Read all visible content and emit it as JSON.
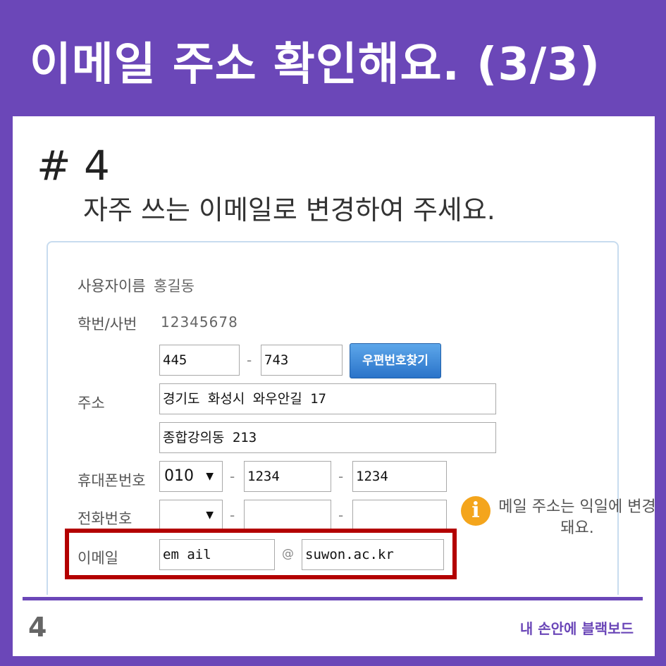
{
  "header": {
    "title": "이메일 주소 확인해요. (3/3)"
  },
  "step": {
    "number": "# 4",
    "subtitle": "자주 쓰는 이메일로 변경하여 주세요."
  },
  "form": {
    "username_label": "사용자이름",
    "username_value": "홍길동",
    "student_id_label": "학번/사번",
    "student_id_value": "12345678",
    "zip1": "445",
    "zip_dash": "-",
    "zip2": "743",
    "zip_button": "우편번호찾기",
    "address_label": "주소",
    "address1": "경기도 화성시 와우안길 17",
    "address2": "종합강의동 213",
    "mobile_label": "휴대폰번호",
    "mobile_prefix": "010",
    "mobile_dash": "-",
    "mobile_mid": "1234",
    "mobile_last": "1234",
    "phone_label": "전화번호",
    "phone_prefix": "",
    "phone_dash": "-",
    "phone_mid": "",
    "phone_last": "",
    "email_label": "이메일",
    "email_id": "em ail",
    "email_at": "@",
    "email_domain": "suwon.ac.kr"
  },
  "info": {
    "icon": "info-icon",
    "text": "메일 주소는 익일에 변경돼요."
  },
  "footer": {
    "page_number": "4",
    "brand": "내 손안에 블랙보드"
  },
  "colors": {
    "header_bg": "#6b47b8",
    "highlight": "#b30000",
    "info_icon": "#f4a51c",
    "button": "#2a73c9"
  }
}
